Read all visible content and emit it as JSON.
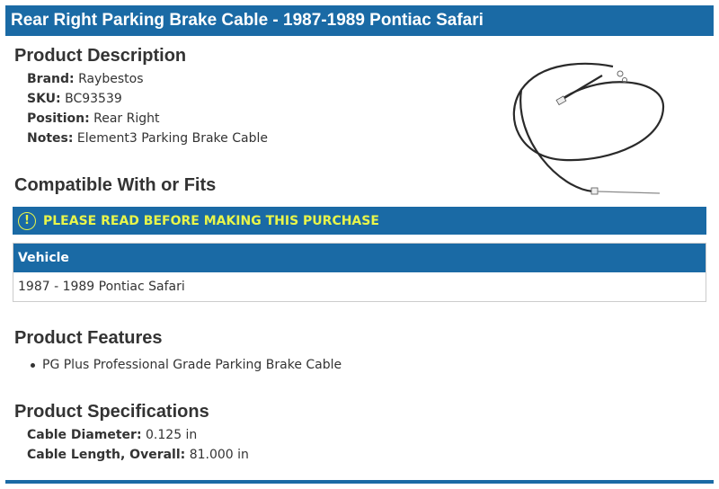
{
  "title": "Rear Right Parking Brake Cable - 1987-1989 Pontiac Safari",
  "description": {
    "heading": "Product Description",
    "items": [
      {
        "label": "Brand:",
        "value": "Raybestos"
      },
      {
        "label": "SKU:",
        "value": "BC93539"
      },
      {
        "label": "Position:",
        "value": "Rear Right"
      },
      {
        "label": "Notes:",
        "value": "Element3 Parking Brake Cable"
      }
    ]
  },
  "compat": {
    "heading": "Compatible With or Fits",
    "notice": "PLEASE READ BEFORE MAKING THIS PURCHASE",
    "notice_icon": "!",
    "table_header": "Vehicle",
    "rows": [
      "1987 - 1989 Pontiac Safari"
    ]
  },
  "features": {
    "heading": "Product Features",
    "items": [
      "PG Plus Professional Grade Parking Brake Cable"
    ]
  },
  "specs": {
    "heading": "Product Specifications",
    "items": [
      {
        "label": "Cable Diameter:",
        "value": "0.125 in"
      },
      {
        "label": "Cable Length, Overall:",
        "value": "81.000 in"
      }
    ]
  },
  "colors": {
    "brand_blue": "#1a6aa5",
    "notice_yellow": "#e8f54a"
  },
  "image": {
    "icon": "parking-brake-cable-image"
  }
}
